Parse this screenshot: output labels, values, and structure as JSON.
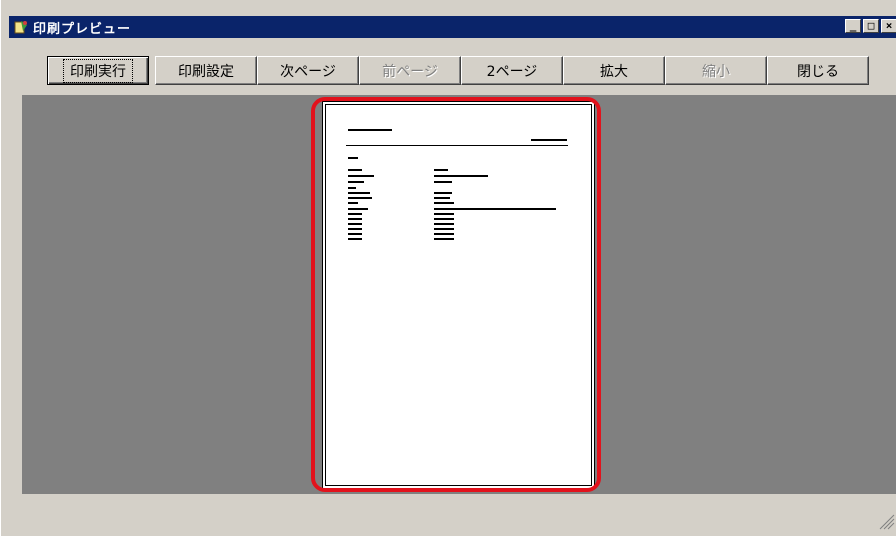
{
  "window": {
    "title": "印刷プレビュー",
    "minimize_glyph": "_",
    "maximize_glyph": "□",
    "close_glyph": "×"
  },
  "toolbar": {
    "buttons": [
      {
        "label": "印刷実行",
        "enabled": true,
        "default": true
      },
      {
        "label": "印刷設定",
        "enabled": true
      },
      {
        "label": "次ページ",
        "enabled": true
      },
      {
        "label": "前ページ",
        "enabled": false
      },
      {
        "label": "2ページ",
        "enabled": true
      },
      {
        "label": "拡大",
        "enabled": true
      },
      {
        "label": "縮小",
        "enabled": false
      },
      {
        "label": "閉じる",
        "enabled": true
      }
    ]
  },
  "colors": {
    "titlebar": "#0a246a",
    "preview_background": "#808080",
    "highlight": "#e2121c"
  }
}
